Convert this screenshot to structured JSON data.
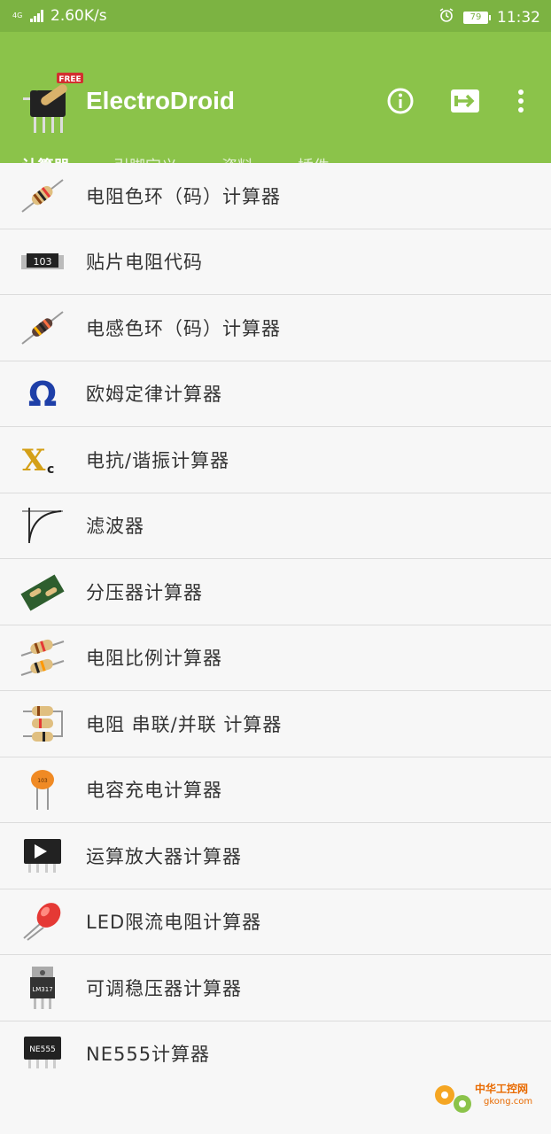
{
  "status_bar": {
    "network": "4G",
    "speed": "2.60K/s",
    "battery": "79",
    "time": "11:32"
  },
  "app_bar": {
    "title": "ElectroDroid",
    "logo_badge": "FREE",
    "colors": {
      "primary": "#8bc34a",
      "status": "#7cb342",
      "text": "#ffffff"
    }
  },
  "tabs": [
    {
      "label": "计算器",
      "active": true
    },
    {
      "label": "引脚定义",
      "active": false
    },
    {
      "label": "资料",
      "active": false
    },
    {
      "label": "插件",
      "active": false
    }
  ],
  "calculators": [
    {
      "label": "电阻色环（码）计算器",
      "icon": "resistor-color-icon"
    },
    {
      "label": "贴片电阻代码",
      "icon": "smd-resistor-icon",
      "icon_text": "103"
    },
    {
      "label": "电感色环（码）计算器",
      "icon": "inductor-icon"
    },
    {
      "label": "欧姆定律计算器",
      "icon": "ohm-icon",
      "icon_text": "Ω"
    },
    {
      "label": "电抗/谐振计算器",
      "icon": "reactance-icon",
      "icon_text": "X"
    },
    {
      "label": "滤波器",
      "icon": "filter-curve-icon"
    },
    {
      "label": "分压器计算器",
      "icon": "voltage-divider-icon"
    },
    {
      "label": "电阻比例计算器",
      "icon": "resistor-ratio-icon"
    },
    {
      "label": "电阻 串联/并联 计算器",
      "icon": "series-parallel-icon"
    },
    {
      "label": "电容充电计算器",
      "icon": "capacitor-icon"
    },
    {
      "label": "运算放大器计算器",
      "icon": "opamp-icon"
    },
    {
      "label": "LED限流电阻计算器",
      "icon": "led-icon"
    },
    {
      "label": "可调稳压器计算器",
      "icon": "voltage-regulator-icon",
      "icon_text": "LM317"
    },
    {
      "label": "NE555计算器",
      "icon": "ne555-icon",
      "icon_text": "NE555"
    }
  ],
  "watermark": {
    "text": "中华工控网",
    "sub": "gkong.com"
  }
}
